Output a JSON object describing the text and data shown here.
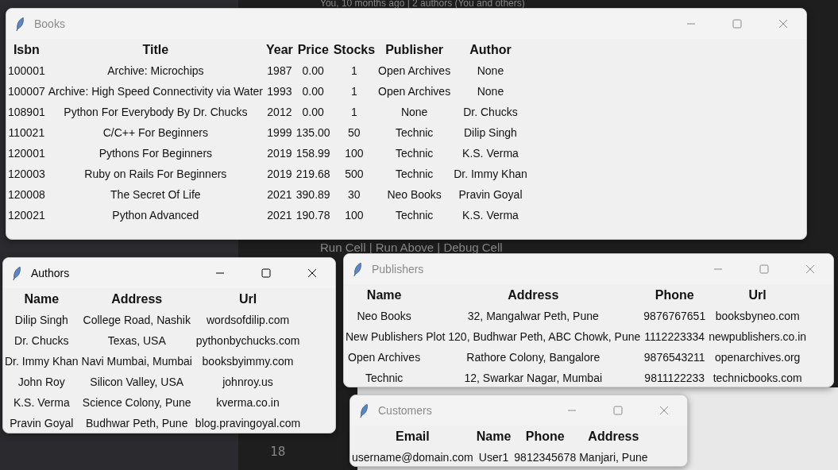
{
  "background": {
    "blame": "You, 10 months ago | 2 authors (You and others)",
    "codelens": "Run Cell | Run Above | Debug Cell",
    "line_number": "18"
  },
  "windows": [
    {
      "title": "Books",
      "active": false,
      "columns": [
        "Isbn",
        "Title",
        "Year",
        "Price",
        "Stocks",
        "Publisher",
        "Author"
      ],
      "rows": [
        [
          "100001",
          "Archive: Microchips",
          "1987",
          "0.00",
          "1",
          "Open Archives",
          "None"
        ],
        [
          "100007",
          "Archive: High Speed Connectivity via Water",
          "1993",
          "0.00",
          "1",
          "Open Archives",
          "None"
        ],
        [
          "108901",
          "Python For Everybody By Dr. Chucks",
          "2012",
          "0.00",
          "1",
          "None",
          "Dr. Chucks"
        ],
        [
          "110021",
          "C/C++ For Beginners",
          "1999",
          "135.00",
          "50",
          "Technic",
          "Dilip Singh"
        ],
        [
          "120001",
          "Pythons For Beginners",
          "2019",
          "158.99",
          "100",
          "Technic",
          "K.S. Verma"
        ],
        [
          "120003",
          "Ruby on Rails For Beginners",
          "2019",
          "219.68",
          "500",
          "Technic",
          "Dr. Immy Khan"
        ],
        [
          "120008",
          "The Secret Of Life",
          "2021",
          "390.89",
          "30",
          "Neo Books",
          "Pravin Goyal"
        ],
        [
          "120021",
          "Python Advanced",
          "2021",
          "190.78",
          "100",
          "Technic",
          "K.S. Verma"
        ]
      ]
    },
    {
      "title": "Authors",
      "active": true,
      "columns": [
        "Name",
        "Address",
        "Url"
      ],
      "rows": [
        [
          "Dilip Singh",
          "College Road, Nashik",
          "wordsofdilip.com"
        ],
        [
          "Dr. Chucks",
          "Texas, USA",
          "pythonbychucks.com"
        ],
        [
          "Dr. Immy Khan",
          "Navi Mumbai, Mumbai",
          "booksbyimmy.com"
        ],
        [
          "John Roy",
          "Silicon Valley, USA",
          "johnroy.us"
        ],
        [
          "K.S. Verma",
          "Science Colony, Pune",
          "kverma.co.in"
        ],
        [
          "Pravin Goyal",
          "Budhwar Peth, Pune",
          "blog.pravingoyal.com"
        ]
      ]
    },
    {
      "title": "Publishers",
      "active": false,
      "columns": [
        "Name",
        "Address",
        "Phone",
        "Url"
      ],
      "rows": [
        [
          "Neo Books",
          "32, Mangalwar Peth, Pune",
          "9876767651",
          "booksbyneo.com"
        ],
        [
          "New Publishers",
          "Plot 120, Budhwar Peth, ABC Chowk, Pune",
          "1112223334",
          "newpublishers.co.in"
        ],
        [
          "Open Archives",
          "Rathore Colony, Bangalore",
          "9876543211",
          "openarchives.org"
        ],
        [
          "Technic",
          "12, Swarkar Nagar, Mumbai",
          "9811122233",
          "technicbooks.com"
        ]
      ]
    },
    {
      "title": "Customers",
      "active": false,
      "columns": [
        "Email",
        "Name",
        "Phone",
        "Address"
      ],
      "rows": [
        [
          "username@domain.com",
          "User1",
          "9812345678",
          "Manjari, Pune"
        ]
      ]
    }
  ]
}
